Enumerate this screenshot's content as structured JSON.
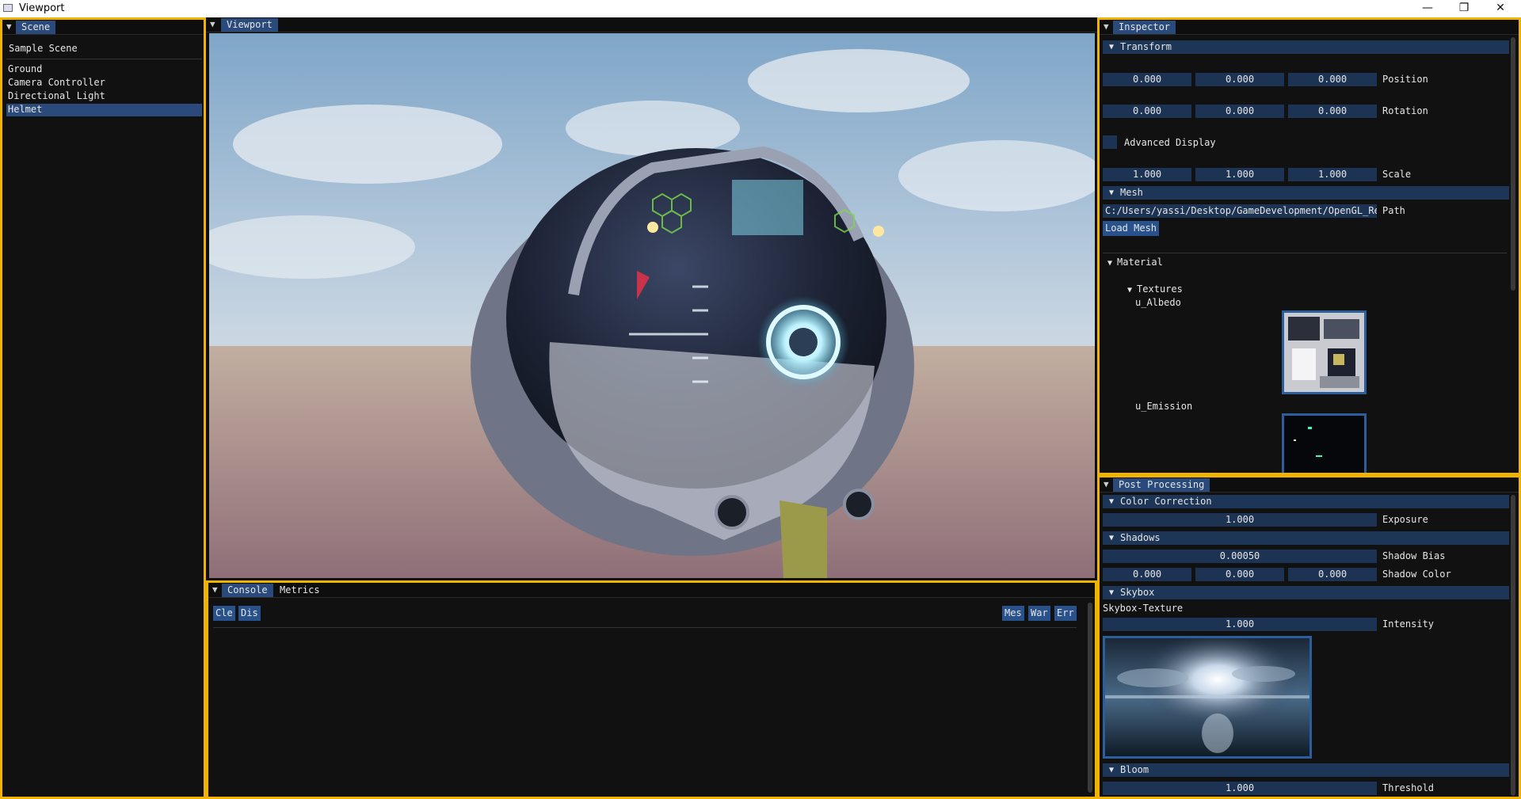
{
  "window": {
    "title": "Viewport",
    "minimize": "—",
    "maximize": "❐",
    "close": "✕"
  },
  "scene": {
    "tab": "Scene",
    "root": "Sample Scene",
    "items": [
      {
        "label": "Ground",
        "selected": false
      },
      {
        "label": "Camera Controller",
        "selected": false
      },
      {
        "label": "Directional Light",
        "selected": false
      },
      {
        "label": "Helmet",
        "selected": true
      }
    ]
  },
  "viewport": {
    "tab": "Viewport"
  },
  "console": {
    "tabs": [
      "Console",
      "Metrics"
    ],
    "buttons_left": [
      "Cle",
      "Dis"
    ],
    "buttons_right": [
      "Mes",
      "War",
      "Err"
    ]
  },
  "inspector": {
    "tab": "Inspector",
    "transform": {
      "header": "Transform",
      "position": {
        "values": [
          "0.000",
          "0.000",
          "0.000"
        ],
        "label": "Position"
      },
      "rotation": {
        "values": [
          "0.000",
          "0.000",
          "0.000"
        ],
        "label": "Rotation"
      },
      "advanced": "Advanced Display",
      "scale": {
        "values": [
          "1.000",
          "1.000",
          "1.000"
        ],
        "label": "Scale"
      }
    },
    "mesh": {
      "header": "Mesh",
      "path_value": "C:/Users/yassi/Desktop/GameDevelopment/OpenGL_Ren",
      "path_label": "Path",
      "load_button": "Load Mesh"
    },
    "material": {
      "header": "Material",
      "textures_header": "Textures",
      "albedo": "u_Albedo",
      "emission": "u_Emission"
    }
  },
  "post": {
    "tab": "Post Processing",
    "color_correction": {
      "header": "Color Correction",
      "exposure_value": "1.000",
      "exposure_label": "Exposure"
    },
    "shadows": {
      "header": "Shadows",
      "bias_value": "0.00050",
      "bias_label": "Shadow Bias",
      "color_values": [
        "0.000",
        "0.000",
        "0.000"
      ],
      "color_label": "Shadow Color"
    },
    "skybox": {
      "header": "Skybox",
      "texture_label": "Skybox-Texture",
      "intensity_value": "1.000",
      "intensity_label": "Intensity"
    },
    "bloom": {
      "header": "Bloom",
      "threshold_value": "1.000",
      "threshold_label": "Threshold"
    }
  },
  "colors": {
    "dock_border": "#f0b400",
    "accent": "#294a7a",
    "field": "#1d3354",
    "header": "#1d3557"
  }
}
